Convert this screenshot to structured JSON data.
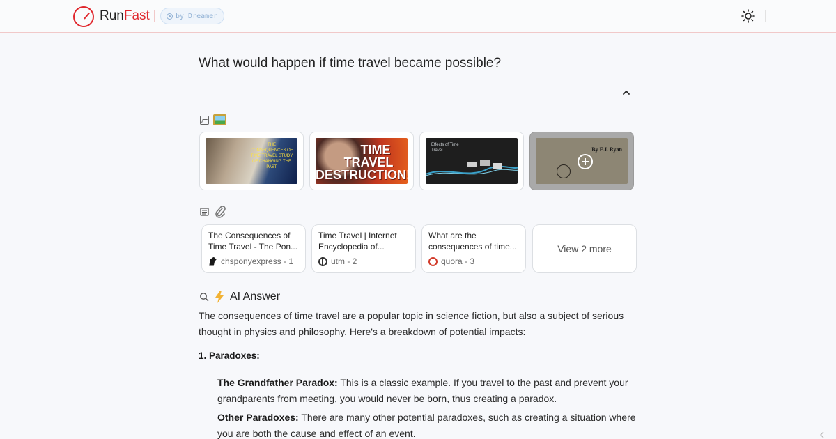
{
  "header": {
    "brand_prefix": "Run",
    "brand_accent": "Fast",
    "by_label": "by Dreamer",
    "accent_color": "#e0282e"
  },
  "question": "What would happen if time travel became possible?",
  "images": {
    "icons": [
      "image-icon",
      "landscape-emoji"
    ],
    "cards": [
      {
        "caption": "THE CONSEQUENCES OF TIME TRAVEL STUDY OF CHANGING THE PAST"
      },
      {
        "line1": "TIME",
        "line2": "TRAVEL",
        "line3": "DESTRUCTION!"
      },
      {
        "caption": "Effects of Time Travel"
      },
      {
        "caption": "By E.I. Ryan"
      }
    ]
  },
  "sources": {
    "icons": [
      "newspaper-icon",
      "paperclip-emoji"
    ],
    "items": [
      {
        "title": "The Consequences of Time Travel - The Pon...",
        "site": "chsponyexpress - 1"
      },
      {
        "title": "Time Travel | Internet Encyclopedia of...",
        "site": "utm - 2"
      },
      {
        "title": "What are the consequences of time...",
        "site": "quora - 3"
      }
    ],
    "more_label": "View 2 more"
  },
  "answer": {
    "heading": "AI Answer",
    "intro": "The consequences of time travel are a popular topic in science fiction, but also a subject of serious thought in physics and philosophy. Here's a breakdown of potential impacts:",
    "section1_heading": "1. Paradoxes:",
    "p1_bold": "The Grandfather Paradox:",
    "p1_text": " This is a classic example. If you travel to the past and prevent your grandparents from meeting, you would never be born, thus creating a paradox.",
    "p2_bold": "Other Paradoxes:",
    "p2_text": " There are many other potential paradoxes, such as creating a situation where you are both the cause and effect of an event."
  }
}
